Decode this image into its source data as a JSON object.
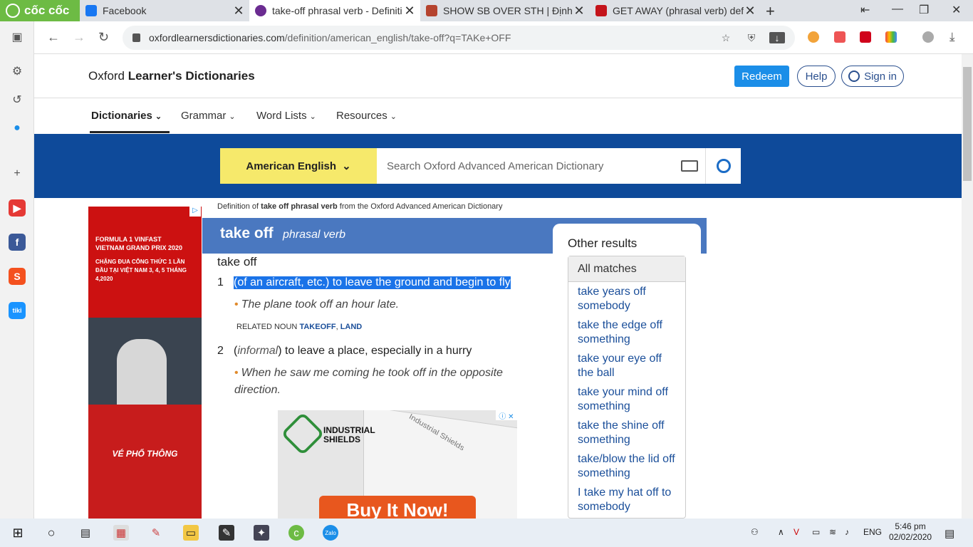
{
  "browser": {
    "brand": "cốc cốc",
    "tabs": [
      {
        "title": "Facebook",
        "color": "#1877f2"
      },
      {
        "title": "take-off phrasal verb - Definiti",
        "color": "#6b2c91"
      },
      {
        "title": "SHOW SB OVER STH | Định ng",
        "color": "#b5432e"
      },
      {
        "title": "GET AWAY (phrasal verb) defi",
        "color": "#c4141b"
      }
    ],
    "url_host": "oxfordlearnersdictionaries.com",
    "url_path": "/definition/american_english/take-off?q=TAKe+OFF",
    "new_tab_icon": "plus-icon"
  },
  "site": {
    "name_plain": "Oxford ",
    "name_bold": "Learner's Dictionaries",
    "redeem": "Redeem",
    "help": "Help",
    "sign_in": "Sign in",
    "menus": [
      "Dictionaries",
      "Grammar",
      "Word Lists",
      "Resources"
    ],
    "dict_select": "American English",
    "search_placeholder": "Search Oxford Advanced American Dictionary",
    "accent_blue": "#0e4a9a",
    "yellow": "#f6e96b"
  },
  "ad_left": {
    "race_title": "FORMULA 1 VINFAST VIETNAM GRAND PRIX 2020",
    "race_sub": "CHẶNG ĐUA CÔNG THỨC 1 LẦN ĐẦU TẠI VIỆT NAM 3, 4, 5 THÁNG 4,2020",
    "cta": "VÉ PHỔ THÔNG"
  },
  "entry": {
    "source_pre": "Definition of ",
    "source_bold": "take off phrasal verb",
    "source_post": " from the Oxford Advanced American Dictionary",
    "headword": "take off",
    "pos": "phrasal verb",
    "phrasal": "take off",
    "senses": [
      {
        "num": "1",
        "def": "(of an aircraft, etc.) to leave the ground and begin to fly",
        "example": "The plane took off an hour late."
      },
      {
        "num": "2",
        "label": "informal",
        "def": " to leave a place, especially in a hurry",
        "example": "When he saw me coming he took off in the opposite direction."
      }
    ],
    "related_label": "RELATED NOUN",
    "related_links": [
      "TAKEOFF",
      "LAND"
    ]
  },
  "ad_bottom": {
    "brand": "INDUSTRIAL SHIELDS",
    "device_label": "Industrial Shields",
    "cta": "Buy It Now!"
  },
  "other_results": {
    "title": "Other results",
    "section": "All matches",
    "items": [
      "take years off somebody",
      "take the edge off something",
      "take your eye off the ball",
      "take your mind off something",
      "take the shine off something",
      "take/blow the lid off something",
      "I take my hat off to somebody"
    ]
  },
  "taskbar": {
    "lang": "ENG",
    "time": "5:46 pm",
    "date": "02/02/2020"
  }
}
